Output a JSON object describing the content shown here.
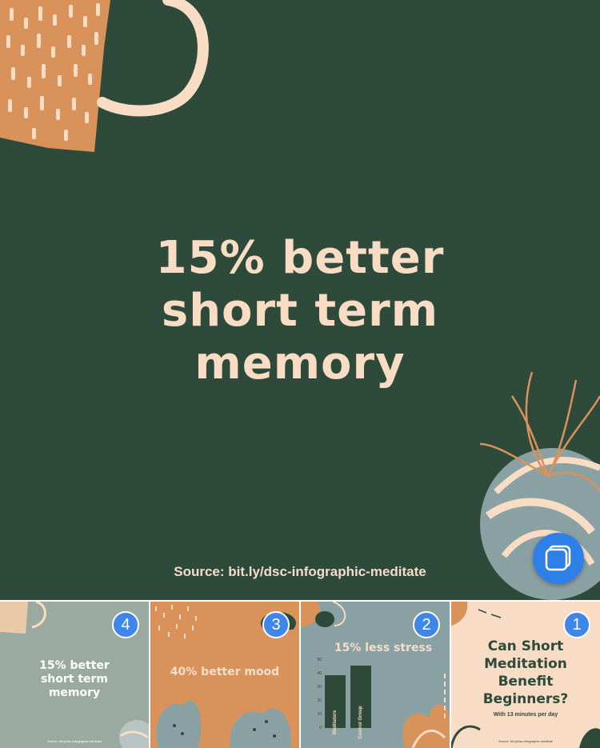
{
  "main_slide": {
    "headline_lines": [
      "15% better",
      "short term",
      "memory"
    ],
    "source": "Source: bit.ly/dsc-infographic-meditate",
    "multi_icon": "multiple-images-icon"
  },
  "thumbnails": [
    {
      "badge": "4",
      "text_lines": [
        "15% better",
        "short term",
        "memory"
      ],
      "source": "Source: bit.ly/dsc-infographic-meditate"
    },
    {
      "badge": "3",
      "text": "40% better mood"
    },
    {
      "badge": "2",
      "title": "15% less stress",
      "chart": {
        "yticks": [
          "50",
          "40",
          "30",
          "20",
          "10",
          "0"
        ],
        "bars": [
          {
            "label": "Meditators",
            "value": 39
          },
          {
            "label": "Control Group",
            "value": 46
          }
        ]
      }
    },
    {
      "badge": "1",
      "title_lines": [
        "Can Short",
        "Meditation",
        "Benefit",
        "Beginners?"
      ],
      "subtitle": "With 13 minutes per day",
      "source": "Source: bit.ly/dsc-infographic-meditate"
    }
  ],
  "colors": {
    "main_bg": "#2e4a3a",
    "cream": "#f8dcc3",
    "orange": "#d9925a",
    "sage": "#8aa1a3",
    "badge_blue": "#3f86ea"
  }
}
